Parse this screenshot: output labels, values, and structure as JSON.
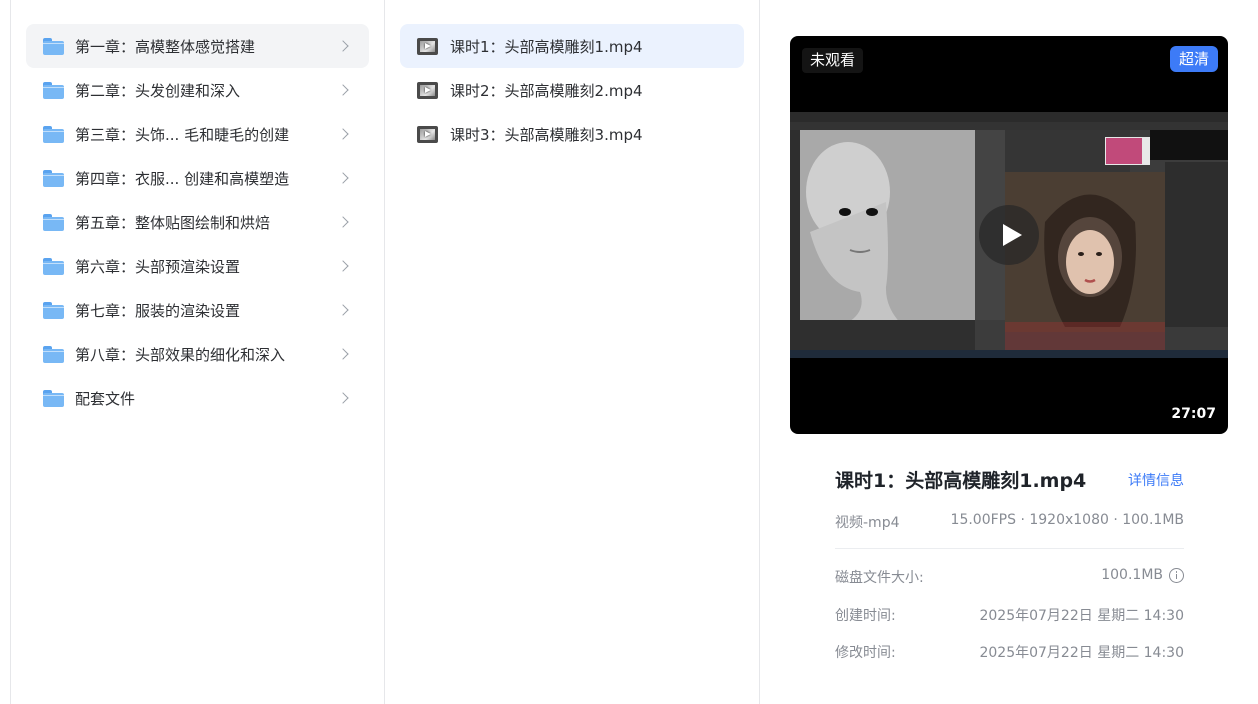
{
  "folders": [
    {
      "label": "第一章：高模整体感觉搭建",
      "active": true
    },
    {
      "label": "第二章：头发创建和深入"
    },
    {
      "label": "第三章：头饰... 毛和睫毛的创建"
    },
    {
      "label": "第四章：衣服... 创建和高模塑造"
    },
    {
      "label": "第五章：整体贴图绘制和烘焙"
    },
    {
      "label": "第六章：头部预渲染设置"
    },
    {
      "label": "第七章：服装的渲染设置"
    },
    {
      "label": "第八章：头部效果的细化和深入"
    },
    {
      "label": "配套文件"
    }
  ],
  "files": [
    {
      "label": "课时1：头部高模雕刻1.mp4",
      "active": true
    },
    {
      "label": "课时2：头部高模雕刻2.mp4"
    },
    {
      "label": "课时3：头部高模雕刻3.mp4"
    }
  ],
  "player": {
    "watch_status": "未观看",
    "quality": "超清",
    "duration": "27:07"
  },
  "detail": {
    "title": "课时1：头部高模雕刻1.mp4",
    "link": "详情信息",
    "type": "视频-mp4",
    "specs": "15.00FPS · 1920x1080 · 100.1MB",
    "rows": [
      {
        "label": "磁盘文件大小:",
        "value": "100.1MB"
      },
      {
        "label": "创建时间:",
        "value": "2025年07月22日 星期二 14:30"
      },
      {
        "label": "修改时间:",
        "value": "2025年07月22日 星期二 14:30"
      }
    ]
  },
  "colors": {
    "accent": "#3d7bf7",
    "active_file_bg": "#ebf2fe",
    "active_folder_bg": "#f3f4f6"
  }
}
